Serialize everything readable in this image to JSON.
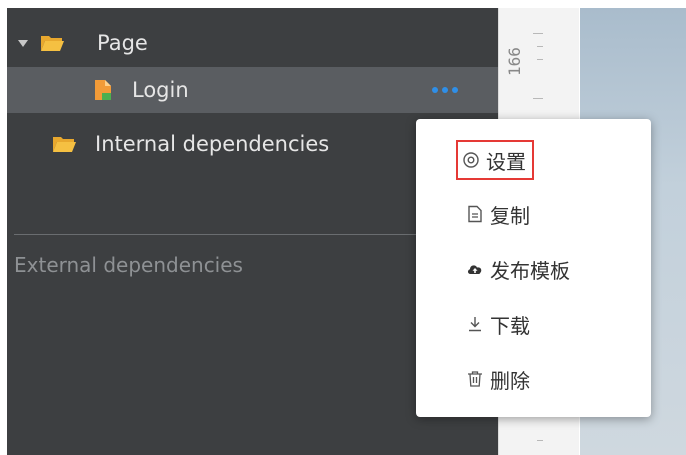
{
  "tree": {
    "page_label": "Page",
    "login_label": "Login",
    "internal_label": "Internal dependencies"
  },
  "external_label": "External dependencies",
  "ruler": {
    "number": "166"
  },
  "context_menu": {
    "items": [
      {
        "label": "设置",
        "icon": "gear-icon"
      },
      {
        "label": "复制",
        "icon": "copy-icon"
      },
      {
        "label": "发布模板",
        "icon": "cloud-upload-icon"
      },
      {
        "label": "下载",
        "icon": "download-icon"
      },
      {
        "label": "删除",
        "icon": "trash-icon"
      }
    ]
  },
  "colors": {
    "sidebar_bg": "#3d3f41",
    "selected_bg": "#5a5d61",
    "folder": "#f5b841",
    "accent_dots": "#2f8fe8",
    "highlight_border": "#e53935"
  }
}
